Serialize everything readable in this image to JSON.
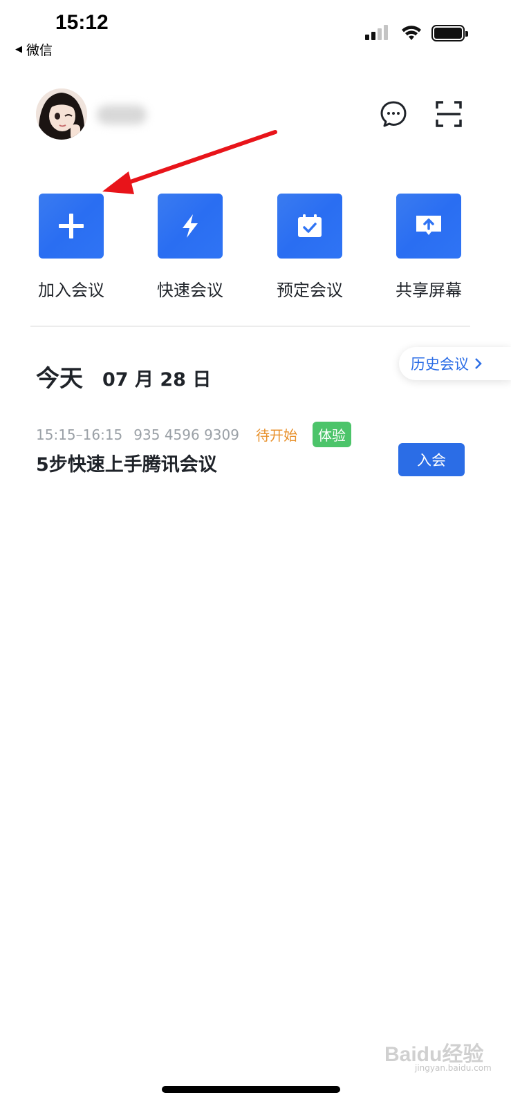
{
  "status_bar": {
    "time": "15:12",
    "back_app": "微信"
  },
  "header": {
    "chat_icon": "chat-bubble-icon",
    "scan_icon": "scan-icon"
  },
  "quick_actions": [
    {
      "label": "加入会议",
      "icon": "plus-icon"
    },
    {
      "label": "快速会议",
      "icon": "lightning-icon"
    },
    {
      "label": "预定会议",
      "icon": "calendar-check-icon"
    },
    {
      "label": "共享屏幕",
      "icon": "screen-share-icon"
    }
  ],
  "schedule": {
    "today_label": "今天",
    "date": "07 月 28 日",
    "history_button": "历史会议"
  },
  "meeting": {
    "time_range": "15:15–16:15",
    "meeting_id": "935 4596 9309",
    "status": "待开始",
    "badge": "体验",
    "title": "5步快速上手腾讯会议",
    "join_label": "入会"
  },
  "watermark": {
    "brand": "Baidu经验",
    "url": "jingyan.baidu.com"
  },
  "colors": {
    "accent": "#2b6de6",
    "status_pending": "#e8912c",
    "badge_green": "#4cc46a",
    "annotation_red": "#e8141a"
  }
}
